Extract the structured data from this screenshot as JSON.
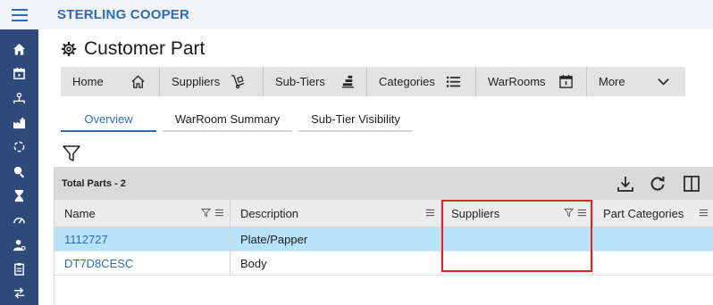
{
  "brand": "STERLING COOPER",
  "page": {
    "title": "Customer Part"
  },
  "nav": [
    {
      "label": "Home",
      "icon": "home-icon"
    },
    {
      "label": "Suppliers",
      "icon": "dolly-icon"
    },
    {
      "label": "Sub-Tiers",
      "icon": "sub-tiers-icon"
    },
    {
      "label": "Categories",
      "icon": "list-icon"
    },
    {
      "label": "WarRooms",
      "icon": "calendar-icon"
    },
    {
      "label": "More",
      "icon": "chevron-down-icon"
    }
  ],
  "subtabs": [
    {
      "label": "Overview",
      "active": true
    },
    {
      "label": "WarRoom Summary",
      "active": false
    },
    {
      "label": "Sub-Tier Visibility",
      "active": false
    }
  ],
  "grid": {
    "total_label": "Total Parts - 2",
    "columns": [
      "Name",
      "Description",
      "Suppliers",
      "Part Categories"
    ],
    "rows": [
      {
        "name": "1112727",
        "description": "Plate/Papper",
        "suppliers": "",
        "part_categories": ""
      },
      {
        "name": "DT7D8CESC",
        "description": "Body",
        "suppliers": "",
        "part_categories": ""
      }
    ]
  },
  "colors": {
    "brand": "#2f6bb5",
    "rail": "#2d4a7a",
    "selected_row": "#b8e2f8",
    "highlight": "#e3212a"
  },
  "rail_icons": [
    "home-icon",
    "calendar-icon",
    "org-icon",
    "factory-icon",
    "refresh-icon",
    "search-user-icon",
    "hourglass-icon",
    "gauge-icon",
    "user-settings-icon",
    "clipboard-icon",
    "transfer-icon"
  ]
}
